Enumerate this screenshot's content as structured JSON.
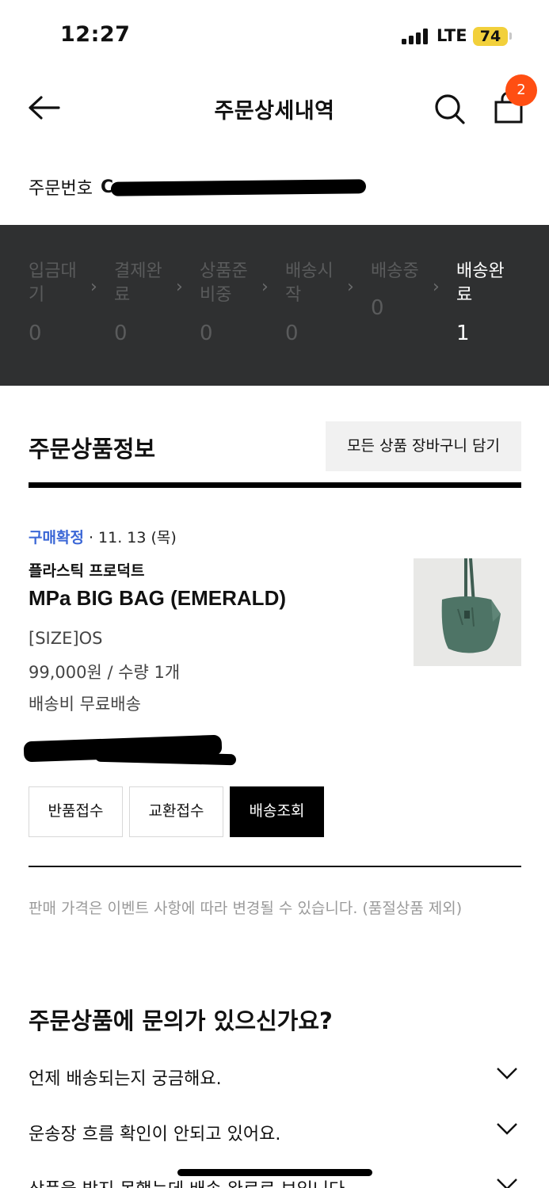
{
  "status_bar": {
    "time": "12:27",
    "network": "LTE",
    "battery": "74"
  },
  "nav": {
    "title": "주문상세내역",
    "cart_badge": "2"
  },
  "order": {
    "number_label": "주문번호",
    "number_value": "C"
  },
  "progress": {
    "steps": [
      {
        "label": "입금대기",
        "count": "0"
      },
      {
        "label": "결제완료",
        "count": "0"
      },
      {
        "label": "상품준비중",
        "count": "0"
      },
      {
        "label": "배송시작",
        "count": "0"
      },
      {
        "label": "배송중",
        "count": "0"
      },
      {
        "label": "배송완료",
        "count": "1"
      }
    ],
    "active_index": 5
  },
  "section": {
    "title": "주문상품정보",
    "cart_all_button": "모든 상품 장바구니 담기"
  },
  "item": {
    "status": "구매확정",
    "date": " · 11. 13 (목)",
    "brand": "플라스틱 프로덕트",
    "name": "MPa BIG BAG (EMERALD)",
    "option": "[SIZE]OS",
    "price_qty": "99,000원 / 수량 1개",
    "shipping": "배송비 무료배송",
    "product_color": "#4e7466"
  },
  "actions": {
    "return": "반품접수",
    "exchange": "교환접수",
    "track": "배송조회"
  },
  "notice": "판매 가격은 이벤트 사항에 따라 변경될 수 있습니다. (품절상품 제외)",
  "faq": {
    "title": "주문상품에 문의가 있으신가요?",
    "items": [
      {
        "q": "언제 배송되는지 궁금해요."
      },
      {
        "q": "운송장 흐름 확인이 안되고 있어요."
      },
      {
        "q": "상품을 받지 못했는데 배송 완료로 보입니다."
      }
    ]
  }
}
